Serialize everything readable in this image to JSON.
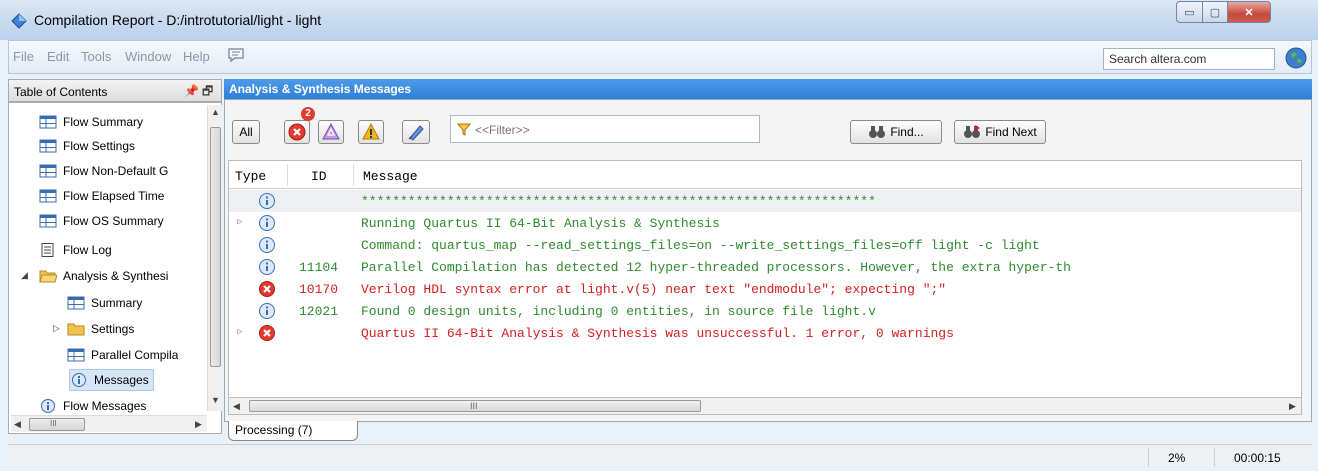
{
  "window": {
    "title": "Compilation Report - D:/introtutorial/light - light",
    "minimize_glyph": "▭",
    "maximize_glyph": "▢",
    "close_glyph": "✕"
  },
  "menu": {
    "items": [
      "File",
      "Edit",
      "Tools",
      "Window",
      "Help"
    ],
    "search_placeholder": "Search altera.com"
  },
  "toc": {
    "title": "Table of Contents",
    "pin_glyph": "📌🗗",
    "items": [
      {
        "label": "Flow Summary",
        "icon": "table-icon"
      },
      {
        "label": "Flow Settings",
        "icon": "table-icon"
      },
      {
        "label": "Flow Non-Default G",
        "icon": "table-icon"
      },
      {
        "label": "Flow Elapsed Time",
        "icon": "table-icon"
      },
      {
        "label": "Flow OS Summary",
        "icon": "table-icon"
      },
      {
        "label": "Flow Log",
        "icon": "document-icon"
      },
      {
        "label": "Analysis & Synthesi",
        "icon": "folder-open-icon"
      },
      {
        "label": "Summary",
        "icon": "table-icon"
      },
      {
        "label": "Settings",
        "icon": "folder-icon"
      },
      {
        "label": "Parallel Compila",
        "icon": "table-icon"
      },
      {
        "label": "Messages",
        "icon": "info-icon"
      },
      {
        "label": "Flow Messages",
        "icon": "info-icon"
      }
    ],
    "hscroll_grip": "III"
  },
  "messages_panel": {
    "title": "Analysis & Synthesis Messages",
    "all_label": "All",
    "error_badge": "2",
    "filter_placeholder": "<<Filter>>",
    "find_label": "Find...",
    "find_next_label": "Find Next",
    "columns": [
      "Type",
      "ID",
      "Message"
    ],
    "rows": [
      {
        "type": "info",
        "id": "",
        "message": "******************************************************************",
        "color": "green",
        "expandable": false
      },
      {
        "type": "info",
        "id": "",
        "message": "Running Quartus II 64-Bit Analysis & Synthesis",
        "color": "green",
        "expandable": true
      },
      {
        "type": "info",
        "id": "",
        "message": "Command: quartus_map --read_settings_files=on --write_settings_files=off light -c light",
        "color": "green",
        "expandable": false
      },
      {
        "type": "info",
        "id": "11104",
        "message": "Parallel Compilation has detected 12 hyper-threaded processors. However, the extra hyper-th",
        "color": "green",
        "expandable": false
      },
      {
        "type": "error",
        "id": "10170",
        "message": "Verilog HDL syntax error at light.v(5) near text \"endmodule\";  expecting \";\"",
        "color": "red",
        "expandable": false
      },
      {
        "type": "info",
        "id": "12021",
        "message": "Found 0 design units, including 0 entities, in source file light.v",
        "color": "green",
        "expandable": false
      },
      {
        "type": "error",
        "id": "",
        "message": "Quartus II 64-Bit Analysis & Synthesis was unsuccessful. 1 error, 0 warnings",
        "color": "red",
        "expandable": true
      }
    ],
    "hscroll_grip": "III",
    "tab_label": "Processing (7)"
  },
  "status": {
    "percent": "2%",
    "elapsed": "00:00:15"
  },
  "colors": {
    "info_text": "#2e8b2e",
    "error_text": "#d42020",
    "panel_header": "#2f7fd8"
  }
}
